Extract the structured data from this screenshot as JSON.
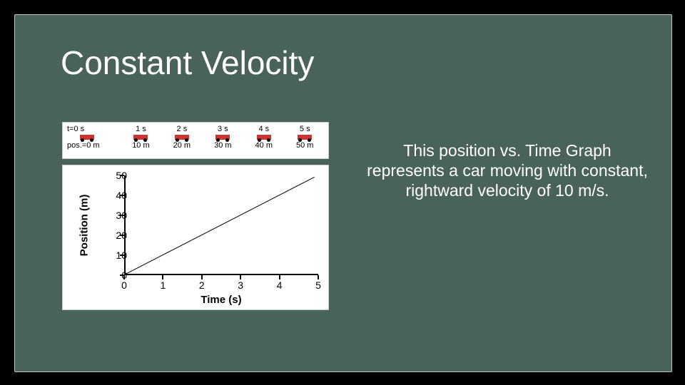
{
  "title": "Constant Velocity",
  "description": "This position vs. Time Graph represents a car moving with constant, rightward velocity of 10 m/s.",
  "timeline": {
    "time_prefix": "t=",
    "pos_prefix": "pos.=",
    "items": [
      {
        "time": "t=0 s",
        "pos": "pos.=0 m"
      },
      {
        "time": "1 s",
        "pos": "10 m"
      },
      {
        "time": "2 s",
        "pos": "20 m"
      },
      {
        "time": "3 s",
        "pos": "30 m"
      },
      {
        "time": "4 s",
        "pos": "40 m"
      },
      {
        "time": "5 s",
        "pos": "50 m"
      }
    ]
  },
  "chart_data": {
    "type": "line",
    "title": "",
    "xlabel": "Time (s)",
    "ylabel": "Position (m)",
    "xlim": [
      0,
      5
    ],
    "ylim": [
      0,
      50
    ],
    "xticks": [
      0,
      1,
      2,
      3,
      4,
      5
    ],
    "yticks": [
      0,
      10,
      20,
      30,
      40,
      50
    ],
    "x": [
      0,
      1,
      2,
      3,
      4,
      5
    ],
    "y": [
      0,
      10,
      20,
      30,
      40,
      50
    ]
  }
}
